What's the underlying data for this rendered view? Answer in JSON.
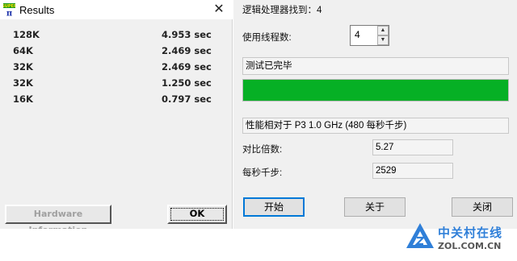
{
  "results": {
    "title": "Results",
    "close_symbol": "✕",
    "rows": [
      {
        "size": "128K",
        "time": "4.953 sec"
      },
      {
        "size": "64K",
        "time": "2.469 sec"
      },
      {
        "size": "32K",
        "time": "2.469 sec"
      },
      {
        "size": "32K",
        "time": "1.250 sec"
      },
      {
        "size": "16K",
        "time": "0.797 sec"
      }
    ],
    "hw_button": "Hardware Information",
    "ok_button": "OK"
  },
  "panel": {
    "processors_found": "逻辑处理器找到：4",
    "threads_label": "使用线程数:",
    "threads_value": "4",
    "status": "测试已完毕",
    "progress_fraction": 1.0,
    "perf_relative": "性能相对于 P3 1.0 GHz (480 每秒千步)",
    "ratio_label": "对比倍数:",
    "ratio_value": "5.27",
    "kps_label": "每秒千步:",
    "kps_value": "2529",
    "start_button": "开始",
    "about_button": "关于",
    "close_button": "关闭"
  },
  "colors": {
    "progress": "#06b025",
    "focus_border": "#0078d7",
    "watermark": "#2f7fd8"
  },
  "watermark": {
    "cn": "中关村在线",
    "en": "ZOL.COM.CN"
  }
}
